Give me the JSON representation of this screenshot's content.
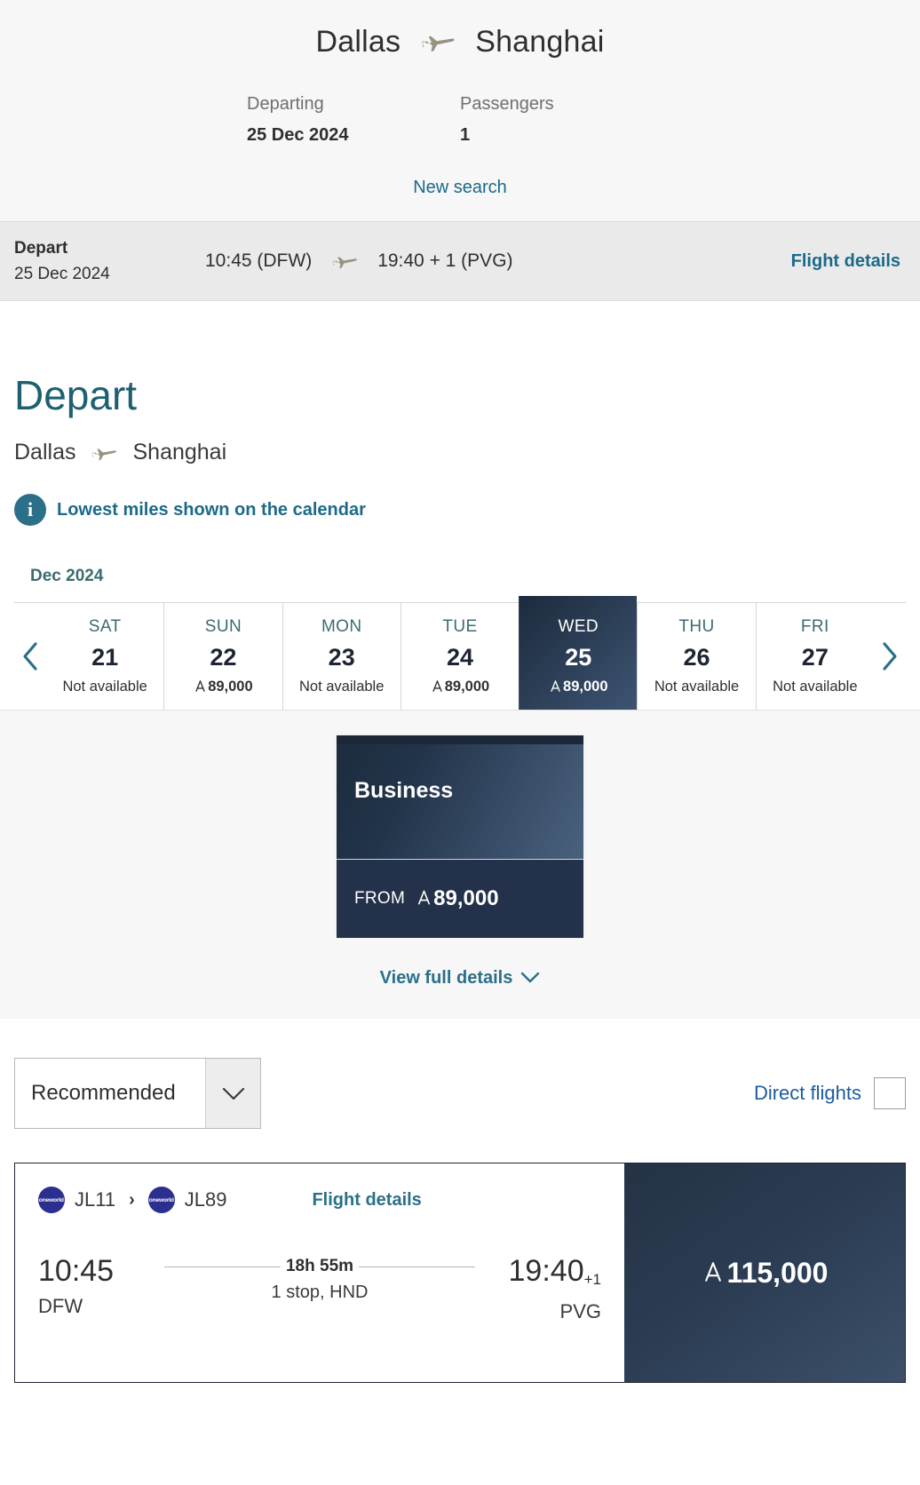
{
  "header": {
    "origin": "Dallas",
    "destination": "Shanghai",
    "plane_icon": "airplane-icon",
    "departing_label": "Departing",
    "departing_value": "25 Dec 2024",
    "passengers_label": "Passengers",
    "passengers_value": "1",
    "new_search": "New search"
  },
  "depart_bar": {
    "title": "Depart",
    "date": "25 Dec 2024",
    "time_from": "10:45 (DFW)",
    "time_to": "19:40 + 1 (PVG)",
    "flight_details": "Flight details"
  },
  "section": {
    "heading": "Depart",
    "origin": "Dallas",
    "destination": "Shanghai",
    "info_icon": "info-icon",
    "info_text": "Lowest miles shown on the calendar"
  },
  "calendar": {
    "month": "Dec 2024",
    "prev_icon": "chevron-left-icon",
    "next_icon": "chevron-right-icon",
    "days": [
      {
        "dow": "SAT",
        "num": "21",
        "price": "Not available",
        "available": false,
        "selected": false
      },
      {
        "dow": "SUN",
        "num": "22",
        "price": "89,000",
        "available": true,
        "selected": false
      },
      {
        "dow": "MON",
        "num": "23",
        "price": "Not available",
        "available": false,
        "selected": false
      },
      {
        "dow": "TUE",
        "num": "24",
        "price": "89,000",
        "available": true,
        "selected": false
      },
      {
        "dow": "WED",
        "num": "25",
        "price": "89,000",
        "available": true,
        "selected": true
      },
      {
        "dow": "THU",
        "num": "26",
        "price": "Not available",
        "available": false,
        "selected": false
      },
      {
        "dow": "FRI",
        "num": "27",
        "price": "Not available",
        "available": false,
        "selected": false
      }
    ]
  },
  "cabin": {
    "name": "Business",
    "from_label": "FROM",
    "price": "89,000",
    "view_details": "View full details",
    "chevron_icon": "chevron-down-icon"
  },
  "filters": {
    "sort_value": "Recommended",
    "sort_chevron_icon": "chevron-down-icon",
    "direct_label": "Direct flights",
    "direct_checked": false
  },
  "flight": {
    "segments": [
      {
        "alliance": "oneworld",
        "code": "JL11"
      },
      {
        "alliance": "oneworld",
        "code": "JL89"
      }
    ],
    "segment_separator_icon": "chevron-right-icon",
    "details_link": "Flight details",
    "depart_time": "10:45",
    "depart_airport": "DFW",
    "arrive_time": "19:40",
    "arrive_day_offset": "+1",
    "arrive_airport": "PVG",
    "duration": "18h 55m",
    "stops": "1 stop, HND",
    "price": "115,000"
  },
  "colors": {
    "accent_teal": "#1b6a8a",
    "heading_teal": "#1f6070",
    "dark_navy": "#1d2433",
    "link_blue": "#1c5c9e",
    "plane_tan": "#9a9281"
  }
}
